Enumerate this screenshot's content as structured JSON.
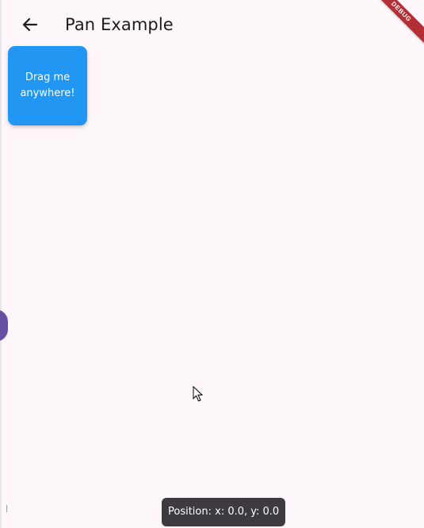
{
  "app_bar": {
    "title": "Pan Example",
    "back_icon": "arrow-left-icon"
  },
  "debug_banner": {
    "label": "DEBUG",
    "color": "#b42e35"
  },
  "drag_box": {
    "label": "Drag me anywhere!",
    "color": "#2196f3"
  },
  "status": {
    "position_text": "Position: x: 0.0, y: 0.0"
  },
  "colors": {
    "background": "#fdf6fb",
    "fab": "#6750a4"
  }
}
